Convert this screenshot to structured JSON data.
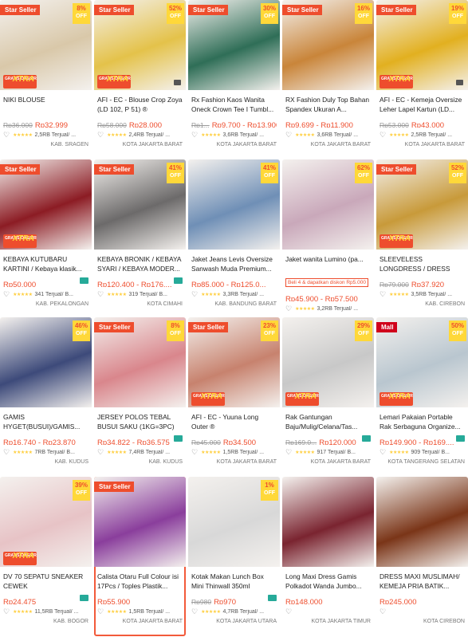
{
  "colors": {
    "accent": "#ee4d2d",
    "star": "#ffce3d",
    "free_shipping_text": "#ffd839",
    "truck": "#26aa99"
  },
  "rows": [
    [
      {
        "badge": "Star Seller",
        "disc": "8%",
        "title": "NIKI BLOUSE",
        "old": "Rp36.000",
        "price": "Rp32.999",
        "sold": "2,5RB Terjual/ ...",
        "loc": "KAB. SRAGEN",
        "img": "#d9c8a9",
        "ongkir": true,
        "video": false
      },
      {
        "badge": "Star Seller",
        "disc": "52%",
        "title": "AFI - EC - Blouse Crop Zoya (LD 102, P 51) ®",
        "old": "Rp58.000",
        "price": "Rp28.000",
        "sold": "2,4RB Terjual/ ...",
        "loc": "KOTA JAKARTA BARAT",
        "img": "#e4c24a",
        "ongkir": true,
        "video": true
      },
      {
        "badge": "Star Seller",
        "disc": "30%",
        "title": "Rx Fashion Kaos Wanita Oneck Crown Tee I Tumbl...",
        "old": "Rp1...",
        "price": "Rp9.700 - Rp13.900",
        "sold": "3,6RB Terjual/ ...",
        "loc": "KOTA JAKARTA BARAT",
        "img": "#2f6e57",
        "ongkir": false,
        "video": false
      },
      {
        "badge": "Star Seller",
        "disc": "16%",
        "title": "RX Fashion Duly Top Bahan Spandex Ukuran A...",
        "old": "",
        "price": "Rp9.699 - Rp11.900",
        "sold": "3,6RB Terjual/ ...",
        "loc": "KOTA JAKARTA BARAT",
        "img": "#c9853a",
        "ongkir": false,
        "video": false
      },
      {
        "badge": "Star Seller",
        "disc": "19%",
        "title": "AFI - EC - Kemeja Oversize Leher Lapel Kartun (LD...",
        "old": "Rp53.000",
        "price": "Rp43.000",
        "sold": "2,5RB Terjual/ ...",
        "loc": "KOTA JAKARTA BARAT",
        "img": "#e2b020",
        "ongkir": true,
        "video": true
      }
    ],
    [
      {
        "badge": "Star Seller",
        "disc": "",
        "title": "KEBAYA KUTUBARU KARTINI / Kebaya klasik...",
        "old": "",
        "price": "Rp50.000",
        "sold": "341 Terjual/ B...",
        "loc": "KAB. PEKALONGAN",
        "img": "#8c1c24",
        "ongkir": true,
        "video": false,
        "truck": true
      },
      {
        "badge": "Star Seller",
        "disc": "41%",
        "title": "KEBAYA BRONIK / KEBAYA SYARI / KEBAYA MODER...",
        "old": "",
        "price": "Rp120.400 - Rp176....",
        "sold": "319 Terjual/ B...",
        "loc": "KOTA CIMAHI",
        "img": "#6c6a6a",
        "ongkir": false,
        "video": false,
        "truck": true
      },
      {
        "badge": "",
        "disc": "41%",
        "title": "Jaket Jeans Levis Oversize Sanwash Muda Premium...",
        "old": "",
        "price": "Rp85.000 - Rp125.0...",
        "sold": "3,3RB Terjual/ ...",
        "loc": "KAB. BANDUNG BARAT",
        "img": "#6f8fb6",
        "ongkir": false,
        "video": false
      },
      {
        "badge": "",
        "disc": "62%",
        "title": "Jaket wanita Lumino (pa...",
        "old": "",
        "price": "Rp45.900 - Rp57.500",
        "sold": "3,2RB Terjual/ ...",
        "loc": "KOTA BANDUNG",
        "img": "#c9a8ba",
        "ongkir": false,
        "video": false,
        "promo": "Beli 4 & dapatkan diskon Rp5.000"
      },
      {
        "badge": "Star Seller",
        "disc": "52%",
        "title": "SLEEVELESS LONGDRESS / DRESS PLISKET WANIT...",
        "old": "Rp79.000",
        "price": "Rp37.920",
        "sold": "3,5RB Terjual/ ...",
        "loc": "KAB. CIREBON",
        "img": "#c89a3a",
        "ongkir": true,
        "video": false
      }
    ],
    [
      {
        "badge": "",
        "disc": "46%",
        "title": "GAMIS HYGET(BUSUI)/GAMIS...",
        "old": "",
        "price": "Rp16.740 - Rp23.870",
        "sold": "7RB Terjual/ B...",
        "loc": "KAB. KUDUS",
        "img": "#3d4a7a",
        "ongkir": false,
        "video": false
      },
      {
        "badge": "Star Seller",
        "disc": "8%",
        "title": "JERSEY POLOS TEBAL BUSUI SAKU (1KG=3PC)",
        "old": "",
        "price": "Rp34.822 - Rp36.575",
        "sold": "7,4RB Terjual/ ...",
        "loc": "KAB. KUDUS",
        "img": "#d9868c",
        "ongkir": false,
        "video": false,
        "truck": true
      },
      {
        "badge": "Star Seller",
        "disc": "23%",
        "title": "AFI - EC - Yuuna Long Outer ®",
        "old": "Rp45.000",
        "price": "Rp34.500",
        "sold": "1,5RB Terjual/ ...",
        "loc": "KOTA JAKARTA BARAT",
        "img": "#c7826e",
        "ongkir": true,
        "video": false
      },
      {
        "badge": "",
        "disc": "29%",
        "title": "Rak Gantungan Baju/Mulig/Celana/Tas...",
        "old": "Rp169.0...",
        "price": "Rp120.000",
        "sold": "917 Terjual/ B...",
        "loc": "KOTA JAKARTA BARAT",
        "img": "#c8c8c8",
        "ongkir": true,
        "video": false,
        "truck": true
      },
      {
        "badge": "Mall",
        "disc": "50%",
        "title": "Lemari Pakaian Portable Rak Serbaguna Organize...",
        "old": "",
        "price": "Rp149.900 - Rp169....",
        "sold": "909 Terjual/ B...",
        "loc": "KOTA TANGERANG SELATAN",
        "img": "#b9c6cf",
        "ongkir": true,
        "video": false,
        "truck": true
      }
    ],
    [
      {
        "badge": "",
        "disc": "39%",
        "title": "DV 70 SEPATU SNEAKER CEWEK",
        "old": "",
        "price": "Rp24.475",
        "sold": "11,5RB Terjual/ ...",
        "loc": "KAB. BOGOR",
        "img": "#e7c3c6",
        "ongkir": true,
        "video": false,
        "truck": true
      },
      {
        "badge": "Star Seller",
        "disc": "",
        "title": "Calista Otaru Full Colour isi 17Pcs / Toples Plastik...",
        "old": "",
        "price": "Rp55.900",
        "sold": "1,5RB Terjual/ ...",
        "loc": "KOTA JAKARTA BARAT",
        "img": "#8a3e9c",
        "ongkir": false,
        "video": false,
        "highlight": true
      },
      {
        "badge": "",
        "disc": "1%",
        "title": "Kotak Makan Lunch Box Mini Thinwall 350ml",
        "old": "Rp980",
        "price": "Rp970",
        "sold": "4,7RB Terjual/ ...",
        "loc": "KOTA JAKARTA UTARA",
        "img": "#d8d8d8",
        "ongkir": false,
        "video": false,
        "truck": true
      },
      {
        "badge": "",
        "disc": "",
        "title": "Long Maxi Dress Gamis Polkadot Wanda Jumbo...",
        "old": "",
        "price": "Rp148.000",
        "sold": "",
        "loc": "KOTA JAKARTA TIMUR",
        "img": "#7a2430",
        "ongkir": false,
        "video": false
      },
      {
        "badge": "",
        "disc": "",
        "title": "DRESS MAXI MUSLIMAH/ KEMEJA PRIA BATIK...",
        "old": "",
        "price": "Rp245.000",
        "sold": "",
        "loc": "KOTA CIREBON",
        "img": "#7a3518",
        "ongkir": false,
        "video": false
      }
    ]
  ],
  "ongkir_text": "GRATIS ONGKIR",
  "ongkir_x": "XTRA",
  "off_text": "OFF",
  "heart_icon": "♡",
  "stars_text": "★★★★★"
}
